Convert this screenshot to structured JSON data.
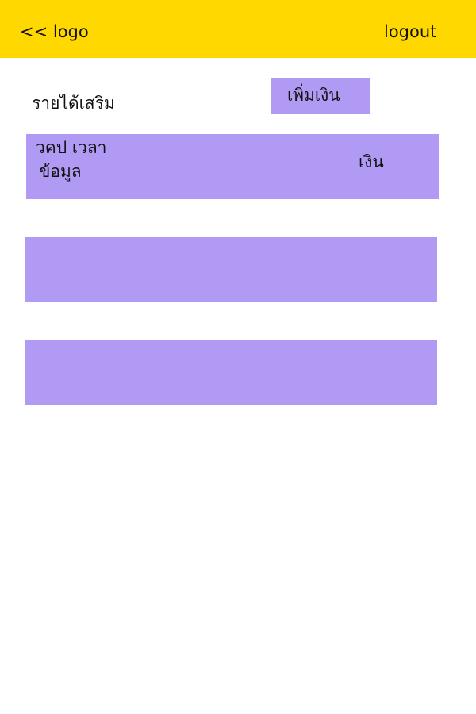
{
  "header": {
    "back_logo_label": "<< logo",
    "logout_label": "logout",
    "background_color": "#ffd800"
  },
  "page": {
    "title": "รายได้เสริม",
    "add_money_label": "เพิ่มเงิน",
    "accent_color": "#b19af4"
  },
  "entries": [
    {
      "date_time": "วคป เวลา",
      "detail": "ข้อมูล",
      "amount": "เงิน"
    },
    {
      "date_time": "",
      "detail": "",
      "amount": ""
    },
    {
      "date_time": "",
      "detail": "",
      "amount": ""
    }
  ]
}
